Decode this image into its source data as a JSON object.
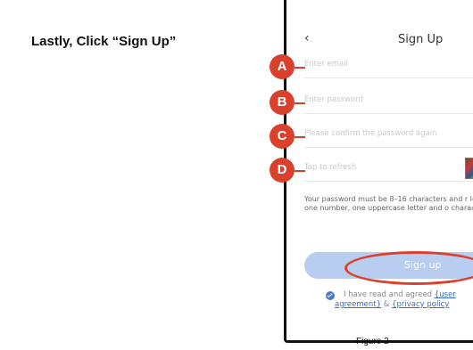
{
  "instruction": "Lastly, Click “Sign Up”",
  "app": {
    "back_icon": "‹",
    "title": "Sign Up",
    "fields": {
      "email_placeholder": "Enter email",
      "password_placeholder": "Enter password",
      "confirm_placeholder": "Please confirm the password again",
      "captcha_placeholder": "Tap to refresh"
    },
    "hint": "Your password must be 8–16 characters and r least: one number, one uppercase letter and o character.",
    "signup_button": "Sign up",
    "agreement": {
      "prefix": "I have read and agreed",
      "link1_a": "{user",
      "link1_b": "agreement}",
      "sep": " & ",
      "link2": "{privacy policy"
    }
  },
  "badges": [
    "A",
    "B",
    "C",
    "D"
  ],
  "caption": "Figure 2",
  "colors": {
    "badge": "#d9412c",
    "button": "#b8cdf0",
    "link": "#3a6bc8",
    "check": "#4a7bd0"
  },
  "icons": [
    "chevron-left-icon",
    "checkmark-circle-icon",
    "captcha-image"
  ]
}
